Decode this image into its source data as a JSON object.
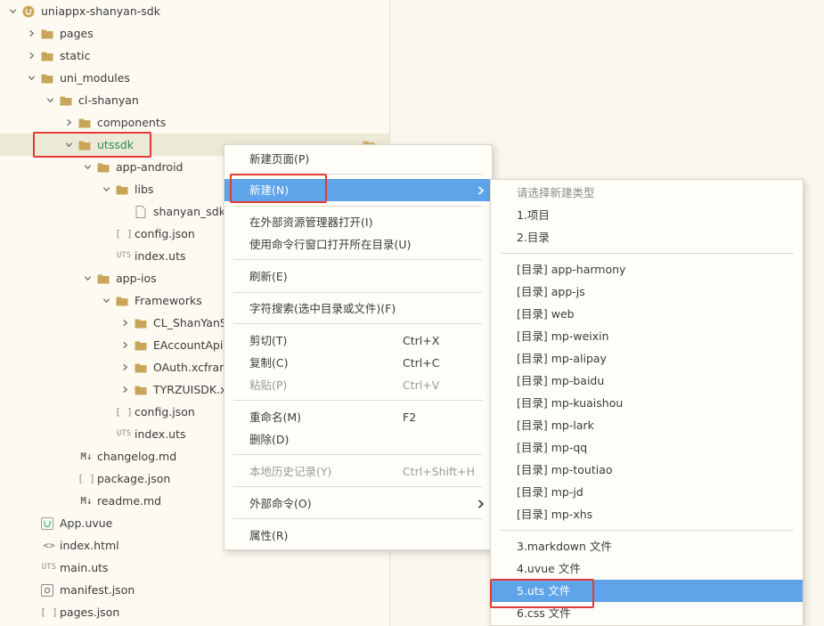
{
  "explorer": {
    "rows": [
      {
        "label": "uniappx-shanyan-sdk",
        "icon": "project-icon",
        "expanded": true
      },
      {
        "label": "pages",
        "icon": "folder-icon",
        "expanded": false
      },
      {
        "label": "static",
        "icon": "folder-icon",
        "expanded": false
      },
      {
        "label": "uni_modules",
        "icon": "folder-icon",
        "expanded": true
      },
      {
        "label": "cl-shanyan",
        "icon": "folder-icon",
        "expanded": true
      },
      {
        "label": "components",
        "icon": "folder-icon",
        "expanded": false
      },
      {
        "label": "utssdk",
        "icon": "folder-icon",
        "expanded": true
      },
      {
        "label": "app-android",
        "icon": "folder-icon",
        "expanded": true
      },
      {
        "label": "libs",
        "icon": "folder-icon",
        "expanded": true
      },
      {
        "label": "shanyan_sdk_",
        "icon": "file-icon"
      },
      {
        "label": "config.json",
        "icon": "json-icon"
      },
      {
        "label": "index.uts",
        "icon": "uts-icon"
      },
      {
        "label": "app-ios",
        "icon": "folder-icon",
        "expanded": true
      },
      {
        "label": "Frameworks",
        "icon": "folder-icon",
        "expanded": true
      },
      {
        "label": "CL_ShanYanSD",
        "icon": "folder-icon",
        "expanded": false
      },
      {
        "label": "EAccountApiS",
        "icon": "folder-icon",
        "expanded": false
      },
      {
        "label": "OAuth.xcframe",
        "icon": "folder-icon",
        "expanded": false
      },
      {
        "label": "TYRZUISDK.xc",
        "icon": "folder-icon",
        "expanded": false
      },
      {
        "label": "config.json",
        "icon": "json-icon"
      },
      {
        "label": "index.uts",
        "icon": "uts-icon"
      },
      {
        "label": "changelog.md",
        "icon": "markdown-icon"
      },
      {
        "label": "package.json",
        "icon": "json-icon"
      },
      {
        "label": "readme.md",
        "icon": "markdown-icon"
      },
      {
        "label": "App.uvue",
        "icon": "vue-file-icon"
      },
      {
        "label": "index.html",
        "icon": "html-icon"
      },
      {
        "label": "main.uts",
        "icon": "uts-icon"
      },
      {
        "label": "manifest.json",
        "icon": "manifest-icon"
      },
      {
        "label": "pages.json",
        "icon": "json-icon"
      }
    ],
    "icon_text": {
      "uts": "UTS",
      "json": "[ ]",
      "markdown": "M↓",
      "html": "<>"
    }
  },
  "context_menu": {
    "items": [
      {
        "label": "新建页面(P)",
        "shortcut": ""
      },
      {
        "label": "新建(N)",
        "shortcut": "",
        "submenu": true,
        "highlighted": true
      },
      {
        "label": "在外部资源管理器打开(I)",
        "shortcut": ""
      },
      {
        "label": "使用命令行窗口打开所在目录(U)",
        "shortcut": ""
      },
      {
        "label": "刷新(E)",
        "shortcut": ""
      },
      {
        "label": "字符搜索(选中目录或文件)(F)",
        "shortcut": ""
      },
      {
        "label": "剪切(T)",
        "shortcut": "Ctrl+X"
      },
      {
        "label": "复制(C)",
        "shortcut": "Ctrl+C"
      },
      {
        "label": "粘贴(P)",
        "shortcut": "Ctrl+V",
        "disabled": true
      },
      {
        "label": "重命名(M)",
        "shortcut": "F2"
      },
      {
        "label": "删除(D)",
        "shortcut": ""
      },
      {
        "label": "本地历史记录(Y)",
        "shortcut": "Ctrl+Shift+H",
        "disabled": true
      },
      {
        "label": "外部命令(O)",
        "shortcut": "",
        "submenu": true
      },
      {
        "label": "属性(R)",
        "shortcut": ""
      }
    ]
  },
  "submenu": {
    "header": "请选择新建类型",
    "items": [
      "1.项目",
      "2.目录",
      "[目录] app-harmony",
      "[目录] app-js",
      "[目录] web",
      "[目录] mp-weixin",
      "[目录] mp-alipay",
      "[目录] mp-baidu",
      "[目录] mp-kuaishou",
      "[目录] mp-lark",
      "[目录] mp-qq",
      "[目录] mp-toutiao",
      "[目录] mp-jd",
      "[目录] mp-xhs",
      "3.markdown 文件",
      "4.uvue 文件",
      "5.uts 文件",
      "6.css 文件"
    ],
    "highlighted_index": 16
  },
  "colors": {
    "folder": "#c9a55a",
    "highlight": "#5fa3e8",
    "annotation_red": "#e53935",
    "vue_green": "#41b883"
  }
}
